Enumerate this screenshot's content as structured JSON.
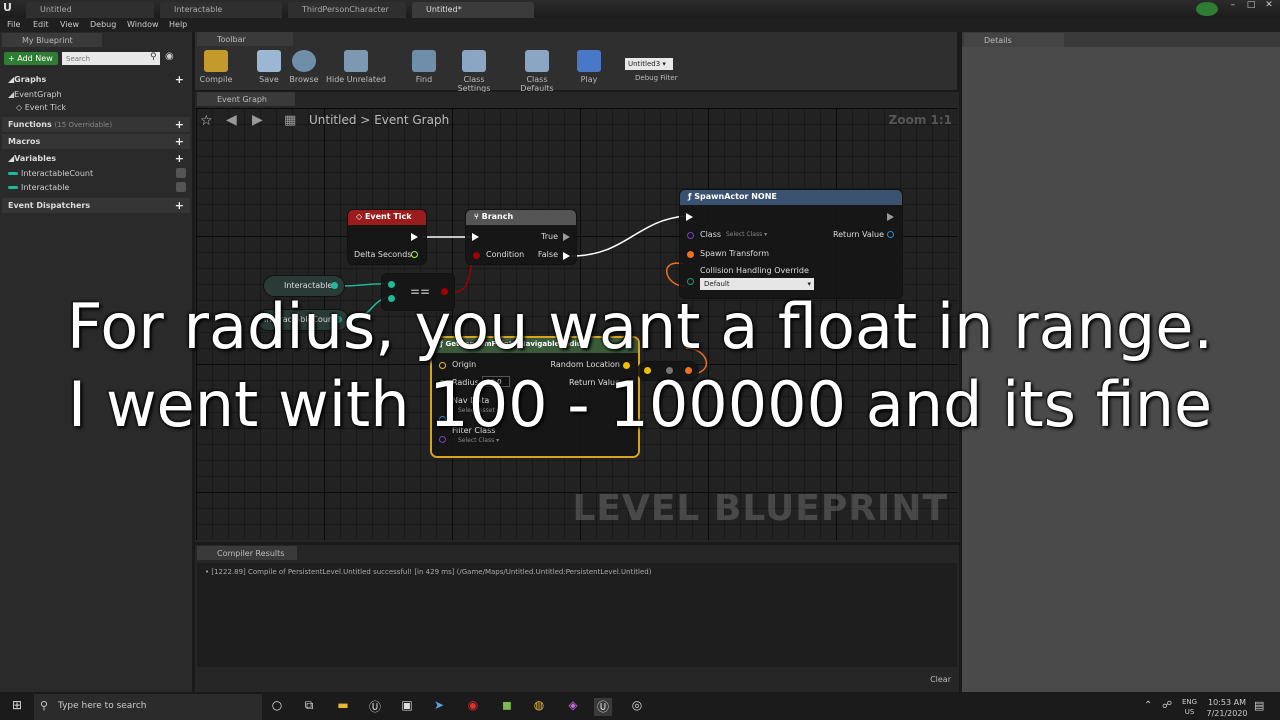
{
  "titlebar": {
    "tabs": [
      "Untitled",
      "Interactable",
      "ThirdPersonCharacter",
      "Untitled*"
    ]
  },
  "menu": [
    "File",
    "Edit",
    "View",
    "Debug",
    "Window",
    "Help"
  ],
  "left_panel": {
    "tab": "My Blueprint",
    "add_new": "Add New",
    "search_placeholder": "Search",
    "graphs_label": "Graphs",
    "graph_items": [
      "EventGraph",
      "Event Tick"
    ],
    "functions_label": "Functions",
    "functions_note": "(15 Overridable)",
    "macros_label": "Macros",
    "variables_label": "Variables",
    "variables": [
      "InteractableCount",
      "Interactable"
    ],
    "dispatchers_label": "Event Dispatchers"
  },
  "toolbar": {
    "tab": "Toolbar",
    "buttons": [
      "Compile",
      "Save",
      "Browse",
      "Hide Unrelated",
      "Find",
      "Class Settings",
      "Class Defaults",
      "Play"
    ],
    "debug_select": "Untitled3",
    "debug_filter": "Debug Filter"
  },
  "graph": {
    "tab": "Event Graph",
    "breadcrumb_root": "Untitled",
    "breadcrumb_sep": ">",
    "breadcrumb_leaf": "Event Graph",
    "zoom": "Zoom 1:1",
    "watermark": "LEVEL BLUEPRINT",
    "nodes": {
      "event_tick": {
        "title": "Event Tick",
        "pin": "Delta Seconds"
      },
      "branch": {
        "title": "Branch",
        "true": "True",
        "false": "False",
        "condition": "Condition"
      },
      "spawn": {
        "title": "SpawnActor NONE",
        "class": "Class",
        "class_select": "Select Class",
        "return": "Return Value",
        "transform": "Spawn Transform",
        "collision": "Collision Handling Override",
        "collision_value": "Default"
      },
      "var_interactable": "Interactable",
      "var_count": "InteractableCount",
      "equals": "==",
      "nav": {
        "title": "GetRandomPointInNavigableRadius",
        "origin": "Origin",
        "random_location": "Random Location",
        "radius": "Radius",
        "radius_value": "50.0",
        "return": "Return Value",
        "navdata": "Nav Data",
        "navdata_select": "Select Asset",
        "filter": "Filter Class",
        "filter_select": "Select Class"
      }
    }
  },
  "details": {
    "tab": "Details"
  },
  "compiler": {
    "tab": "Compiler Results",
    "message": "[1222.89] Compile of PersistentLevel.Untitled successful! [in 429 ms] (/Game/Maps/Untitled.Untitled:PersistentLevel.Untitled)",
    "clear": "Clear"
  },
  "subtitle": {
    "line1": "For radius, you want a float in range.",
    "line2": "I went with 100 - 100000 and its fine"
  },
  "taskbar": {
    "search_placeholder": "Type here to search",
    "lang": "ENG",
    "region": "US",
    "time": "10:53 AM",
    "date": "7/21/2020"
  },
  "colors": {
    "exec": "#ffffff",
    "bool_pin": "#a00000",
    "object_pin": "#1fb89a",
    "vector_pin": "#f0c000",
    "float_pin": "#a7ff39",
    "struct_pin": "#f07020",
    "event_head": "#9b1c1c",
    "branch_head": "#555555",
    "spawn_head": "#3a5270",
    "nav_head": "#3a5a3a"
  }
}
